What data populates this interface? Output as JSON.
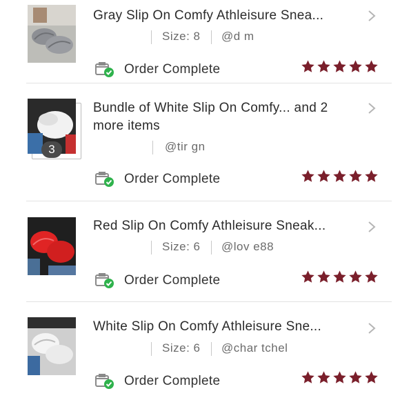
{
  "orders": [
    {
      "title": "Gray Slip On Comfy Athleisure Snea...",
      "size": "Size: 8",
      "handle": "@d    m",
      "status": "Order Complete",
      "rating": 5,
      "thumb_icon": "gray-sneaker-photo",
      "star_color": "#7a1f2b"
    },
    {
      "title": "Bundle of White Slip On Comfy... and 2 more items",
      "size": "",
      "handle": "@tir    gn",
      "status": "Order Complete",
      "rating": 5,
      "item_count": "3",
      "thumb_icon": "white-sneaker-bundle-photo",
      "star_color": "#7a1f2b"
    },
    {
      "title": "Red Slip On Comfy Athleisure Sneak...",
      "size": "Size: 6",
      "handle": "@lov    e88",
      "status": "Order Complete",
      "rating": 5,
      "thumb_icon": "red-sneaker-photo",
      "star_color": "#7a1f2b"
    },
    {
      "title": "White Slip On Comfy Athleisure Sne...",
      "size": "Size: 6",
      "handle": "@char    tchel",
      "status": "Order Complete",
      "rating": 5,
      "thumb_icon": "white-sneaker-photo",
      "star_color": "#7a1f2b"
    }
  ],
  "colors": {
    "star": "#7a1f2b",
    "check_badge": "#2fb24c"
  }
}
